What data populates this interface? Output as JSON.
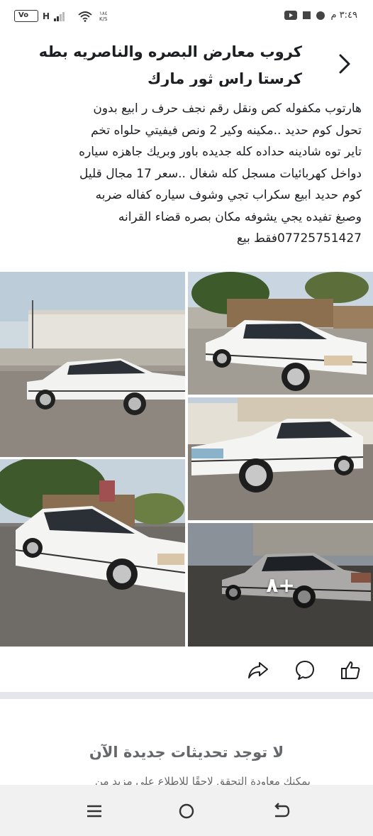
{
  "status_bar": {
    "time": "٣:٤٩ م",
    "network_type": "H",
    "speed_value": "١٨٤",
    "speed_unit": "K/S",
    "volte": "Vo"
  },
  "header": {
    "title_line1": "كروب معارض البصره والناصريه بطه",
    "title_line2": "كرستا راس ثور مارك"
  },
  "post": {
    "lines": [
      "هارتوب مكفوله كص ونقل رقم نجف حرف ر ابيع بدون",
      "تحول كوم حديد ..مكينه وكير 2 ونص فيفيتي حلواه تخم",
      "تاير توه شادينه حداده كله جديده باور وبريك جاهزه سياره",
      "دواخل كهربائيات مسجل كله شغال ..سعر 17 مجال قليل",
      "كوم حديد ابيع سكراب تجي وشوف سياره كفاله ضربه",
      "وصبغ تفيده يجي يشوفه مكان بصره قضاء القرانه",
      "07725751427فقط بيع"
    ]
  },
  "photos": {
    "more_count": "٨+"
  },
  "actions": {
    "share_icon": "share-icon",
    "comment_icon": "comment-icon",
    "like_icon": "like-icon"
  },
  "feed_end": {
    "title": "لا توجد تحديثات جديدة الآن",
    "subtitle": "يمكنك معاودة التحقق لاحقًا للاطلاع على مزيد من"
  },
  "colors": {
    "text_primary": "#1c1e21",
    "text_secondary": "#65676b",
    "divider": "#e4e6eb",
    "nav_bg": "#f1f1f1"
  }
}
